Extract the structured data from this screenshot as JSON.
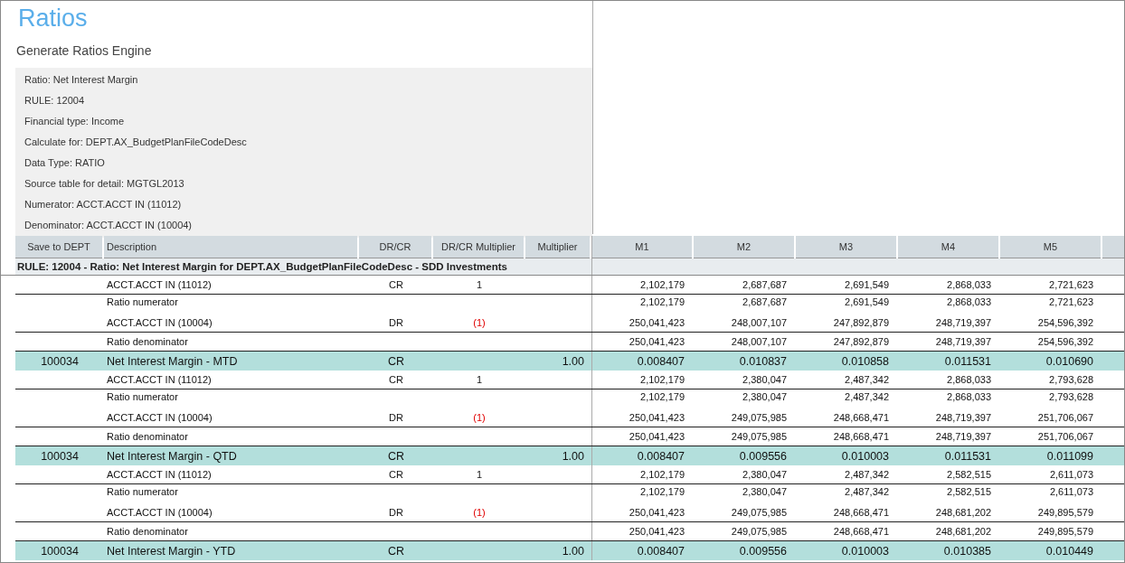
{
  "title": "Ratios",
  "subtitle": "Generate Ratios Engine",
  "info_lines": [
    "Ratio: Net Interest Margin",
    "RULE: 12004",
    "Financial type: Income",
    "Calculate for: DEPT.AX_BudgetPlanFileCodeDesc",
    "Data Type: RATIO",
    "Source table for detail: MGTGL2013",
    "Numerator: ACCT.ACCT IN (11012)",
    "Denominator: ACCT.ACCT IN (10004)"
  ],
  "table": {
    "columns": [
      "Save to DEPT",
      "Description",
      "DR/CR",
      "DR/CR Multiplier",
      "Multiplier",
      "M1",
      "M2",
      "M3",
      "M4",
      "M5"
    ],
    "rule_row": "RULE: 12004 - Ratio: Net Interest Margin for DEPT.AX_BudgetPlanFileCodeDesc - SDD Investments",
    "rows": [
      {
        "kind": "account",
        "description": "ACCT.ACCT IN (11012)",
        "dr_cr": "CR",
        "dr_cr_multiplier": "1",
        "negative": false,
        "values": [
          "2,102,179",
          "2,687,687",
          "2,691,549",
          "2,868,033",
          "2,721,623"
        ]
      },
      {
        "kind": "numerator",
        "description": "Ratio numerator",
        "values": [
          "2,102,179",
          "2,687,687",
          "2,691,549",
          "2,868,033",
          "2,721,623"
        ]
      },
      {
        "kind": "account",
        "description": "ACCT.ACCT IN (10004)",
        "dr_cr": "DR",
        "dr_cr_multiplier": "(1)",
        "negative": true,
        "values": [
          "250,041,423",
          "248,007,107",
          "247,892,879",
          "248,719,397",
          "254,596,392"
        ]
      },
      {
        "kind": "denominator",
        "description": "Ratio denominator",
        "values": [
          "250,041,423",
          "248,007,107",
          "247,892,879",
          "248,719,397",
          "254,596,392"
        ]
      },
      {
        "kind": "result",
        "save_to_dept": "100034",
        "description": "Net Interest Margin - MTD",
        "dr_cr": "CR",
        "multiplier": "1.00",
        "values": [
          "0.008407",
          "0.010837",
          "0.010858",
          "0.011531",
          "0.010690"
        ]
      },
      {
        "kind": "account",
        "description": "ACCT.ACCT IN (11012)",
        "dr_cr": "CR",
        "dr_cr_multiplier": "1",
        "negative": false,
        "values": [
          "2,102,179",
          "2,380,047",
          "2,487,342",
          "2,868,033",
          "2,793,628"
        ]
      },
      {
        "kind": "numerator",
        "description": "Ratio numerator",
        "values": [
          "2,102,179",
          "2,380,047",
          "2,487,342",
          "2,868,033",
          "2,793,628"
        ]
      },
      {
        "kind": "account",
        "description": "ACCT.ACCT IN (10004)",
        "dr_cr": "DR",
        "dr_cr_multiplier": "(1)",
        "negative": true,
        "values": [
          "250,041,423",
          "249,075,985",
          "248,668,471",
          "248,719,397",
          "251,706,067"
        ]
      },
      {
        "kind": "denominator",
        "description": "Ratio denominator",
        "values": [
          "250,041,423",
          "249,075,985",
          "248,668,471",
          "248,719,397",
          "251,706,067"
        ]
      },
      {
        "kind": "result",
        "save_to_dept": "100034",
        "description": "Net Interest Margin - QTD",
        "dr_cr": "CR",
        "multiplier": "1.00",
        "values": [
          "0.008407",
          "0.009556",
          "0.010003",
          "0.011531",
          "0.011099"
        ]
      },
      {
        "kind": "account",
        "description": "ACCT.ACCT IN (11012)",
        "dr_cr": "CR",
        "dr_cr_multiplier": "1",
        "negative": false,
        "values": [
          "2,102,179",
          "2,380,047",
          "2,487,342",
          "2,582,515",
          "2,611,073"
        ]
      },
      {
        "kind": "numerator",
        "description": "Ratio numerator",
        "values": [
          "2,102,179",
          "2,380,047",
          "2,487,342",
          "2,582,515",
          "2,611,073"
        ]
      },
      {
        "kind": "account",
        "description": "ACCT.ACCT IN (10004)",
        "dr_cr": "DR",
        "dr_cr_multiplier": "(1)",
        "negative": true,
        "values": [
          "250,041,423",
          "249,075,985",
          "248,668,471",
          "248,681,202",
          "249,895,579"
        ]
      },
      {
        "kind": "denominator",
        "description": "Ratio denominator",
        "values": [
          "250,041,423",
          "249,075,985",
          "248,668,471",
          "248,681,202",
          "249,895,579"
        ]
      },
      {
        "kind": "result",
        "save_to_dept": "100034",
        "description": "Net Interest Margin - YTD",
        "dr_cr": "CR",
        "multiplier": "1.00",
        "values": [
          "0.008407",
          "0.009556",
          "0.010003",
          "0.010385",
          "0.010449"
        ]
      }
    ]
  }
}
